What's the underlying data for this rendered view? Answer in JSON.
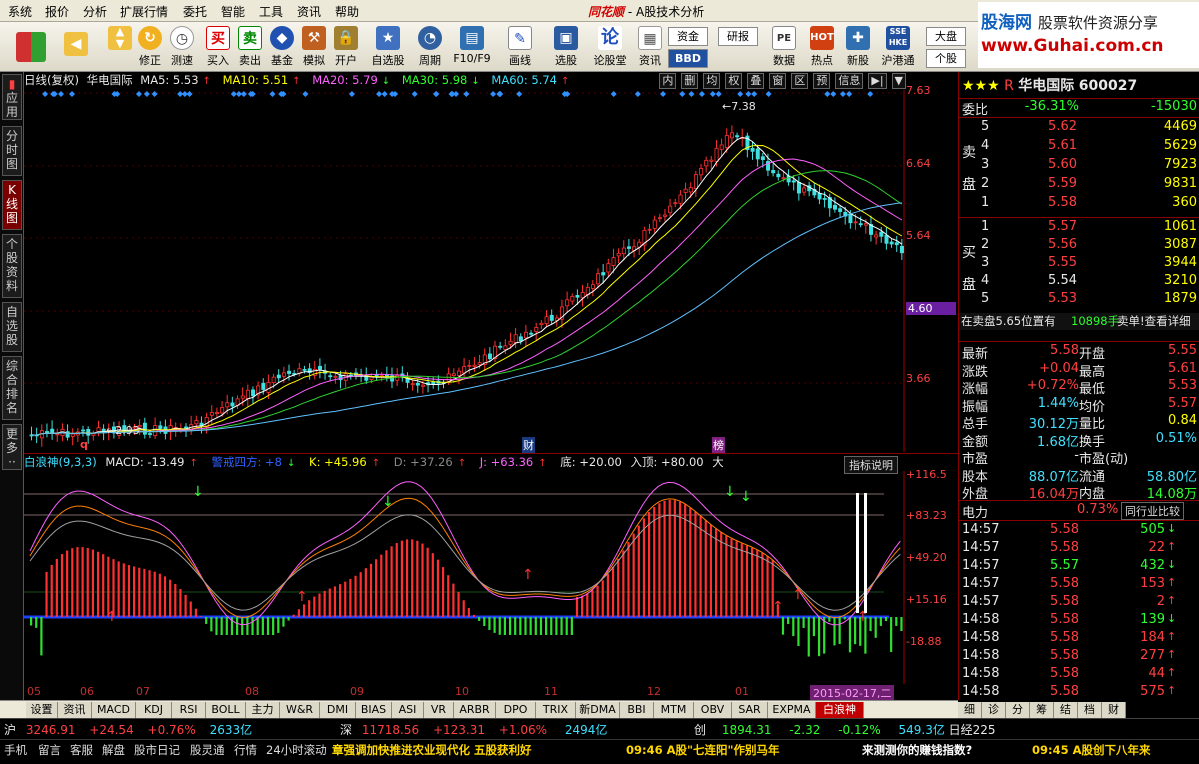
{
  "menu": {
    "items": [
      "系统",
      "报价",
      "分析",
      "扩展行情",
      "委托",
      "智能",
      "工具",
      "资讯",
      "帮助"
    ],
    "title_brand": "同花顺",
    "title_text": "- A股技术分析"
  },
  "toolbar": {
    "buttons": [
      "修正",
      "测速",
      "买入",
      "卖出",
      "基金",
      "模拟",
      "开户",
      "自选股",
      "周期",
      "F10/F9",
      "画线",
      "选股",
      "论股堂",
      "资讯",
      "数据",
      "热点",
      "新股",
      "沪港通"
    ],
    "boxes": [
      "资金",
      "研报",
      "BBD",
      "大盘",
      "个股"
    ]
  },
  "watermark": {
    "line1": "股海网",
    "line1b": "股票软件资源分享",
    "line2": "www.Guhai.com.cn"
  },
  "leftnav": {
    "items": [
      "应用",
      "分时图",
      "K线图",
      "个股资料",
      "自选股",
      "综合排名",
      "更多"
    ]
  },
  "chart": {
    "info": {
      "period": "日线(复权)",
      "name": "华电国际",
      "ma5": "MA5: 5.53",
      "ma10": "MA10: 5.51",
      "ma20": "MA20: 5.79",
      "ma30": "MA30: 5.98",
      "ma60": "MA60: 5.74",
      "arrow_up": "↑",
      "arrow_down": "↓"
    },
    "topbtns": [
      "内",
      "删",
      "均",
      "权",
      "叠",
      "窗",
      "区",
      "预",
      "信息"
    ],
    "ylabels": [
      "7.63",
      "6.64",
      "5.64",
      "4.60",
      "3.66"
    ],
    "hi": "7.38",
    "lo": "2.93",
    "marker_q": "q",
    "marker_cai": "财",
    "marker_bang": "榜",
    "ind": {
      "name": "白浪神(9,3,3)",
      "macd": "MACD: -13.49",
      "warn": "警戒四方: +8",
      "k": "K: +45.96",
      "d": "D: +37.26",
      "j": "J: +63.36",
      "di": "底: +20.00",
      "ru": "入顶: +80.00",
      "da": "大",
      "explain": "指标说明"
    },
    "ind_ylabels": [
      "+116.5",
      "+83.23",
      "+49.20",
      "+15.16",
      "-18.88"
    ],
    "months": [
      "05",
      "06",
      "07",
      "08",
      "09",
      "10",
      "11",
      "12",
      "01"
    ],
    "cursor_date": "2015-02-17,二"
  },
  "tabs": [
    "设置",
    "资讯",
    "MACD",
    "KDJ",
    "RSI",
    "BOLL",
    "主力",
    "W&R",
    "DMI",
    "BIAS",
    "ASI",
    "VR",
    "ARBR",
    "DPO",
    "TRIX",
    "新DMA",
    "BBI",
    "MTM",
    "OBV",
    "SAR",
    "EXPMA",
    "白浪神"
  ],
  "rtabs": [
    "细",
    "诊",
    "分",
    "筹",
    "结",
    "档",
    "财"
  ],
  "quote": {
    "stars": "★★★",
    "r": "R",
    "name": "华电国际",
    "code": "600027",
    "weibi": {
      "l": "委比",
      "v": "-36.31%",
      "v2": "-15030"
    },
    "sell": [
      [
        "5",
        "5.62",
        "4469"
      ],
      [
        "4",
        "5.61",
        "5629"
      ],
      [
        "3",
        "5.60",
        "7923"
      ],
      [
        "2",
        "5.59",
        "9831"
      ],
      [
        "1",
        "5.58",
        "360"
      ]
    ],
    "sell_label": [
      "卖",
      "盘"
    ],
    "buy": [
      [
        "1",
        "5.57",
        "1061"
      ],
      [
        "2",
        "5.56",
        "3087"
      ],
      [
        "3",
        "5.55",
        "3944"
      ],
      [
        "4",
        "5.54",
        "3210"
      ],
      [
        "5",
        "5.53",
        "1879"
      ]
    ],
    "buy_label": [
      "买",
      "盘"
    ],
    "notice": "在卖盘5.65位置有",
    "notice2": "10898手",
    "notice3": "卖单!查看详细",
    "stats": [
      [
        "最新",
        "5.58",
        "开盘",
        "5.55"
      ],
      [
        "涨跌",
        "+0.04",
        "最高",
        "5.61"
      ],
      [
        "涨幅",
        "+0.72%",
        "最低",
        "5.53"
      ],
      [
        "振幅",
        "1.44%",
        "均价",
        "5.57"
      ],
      [
        "总手",
        "30.12万",
        "量比",
        "0.84"
      ],
      [
        "金额",
        "1.68亿",
        "换手",
        "0.51%"
      ],
      [
        "市盈",
        "-",
        "市盈(动)",
        ""
      ],
      [
        "股本",
        "88.07亿",
        "流通",
        "58.80亿"
      ],
      [
        "外盘",
        "16.04万",
        "内盘",
        "14.08万"
      ]
    ],
    "sector": {
      "name": "电力",
      "chg": "0.73%",
      "btn": "同行业比较"
    },
    "ticks": [
      [
        "14:57",
        "5.58",
        "505"
      ],
      [
        "14:57",
        "5.58",
        "22"
      ],
      [
        "14:57",
        "5.57",
        "432"
      ],
      [
        "14:57",
        "5.58",
        "153"
      ],
      [
        "14:57",
        "5.58",
        "2"
      ],
      [
        "14:58",
        "5.58",
        "139"
      ],
      [
        "14:58",
        "5.58",
        "184"
      ],
      [
        "14:58",
        "5.58",
        "277"
      ],
      [
        "14:58",
        "5.58",
        "44"
      ],
      [
        "14:58",
        "5.58",
        "575"
      ]
    ]
  },
  "status": {
    "sh": {
      "l": "沪",
      "v": "3246.91",
      "c": "+24.54",
      "p": "+0.76%",
      "amt": "2633亿"
    },
    "sz": {
      "l": "深",
      "v": "11718.56",
      "c": "+123.31",
      "p": "+1.06%",
      "amt": "2494亿"
    },
    "cy": {
      "l": "创",
      "v": "1894.31",
      "c": "-2.32",
      "p": "-0.12%",
      "amt": "549.3亿"
    },
    "rj": {
      "l": "日经225"
    },
    "links": [
      "手机",
      "留言",
      "客服",
      "解盘",
      "股市日记",
      "股灵通",
      "行情",
      "24小时滚动"
    ],
    "news1": "章强调加快推进农业现代化 五股获利好",
    "news2": "09:46 A股\"七连阳\"作别马年",
    "news3": "来测测你的赚钱指数?",
    "news4": "09:45 A股创下八年来"
  }
}
